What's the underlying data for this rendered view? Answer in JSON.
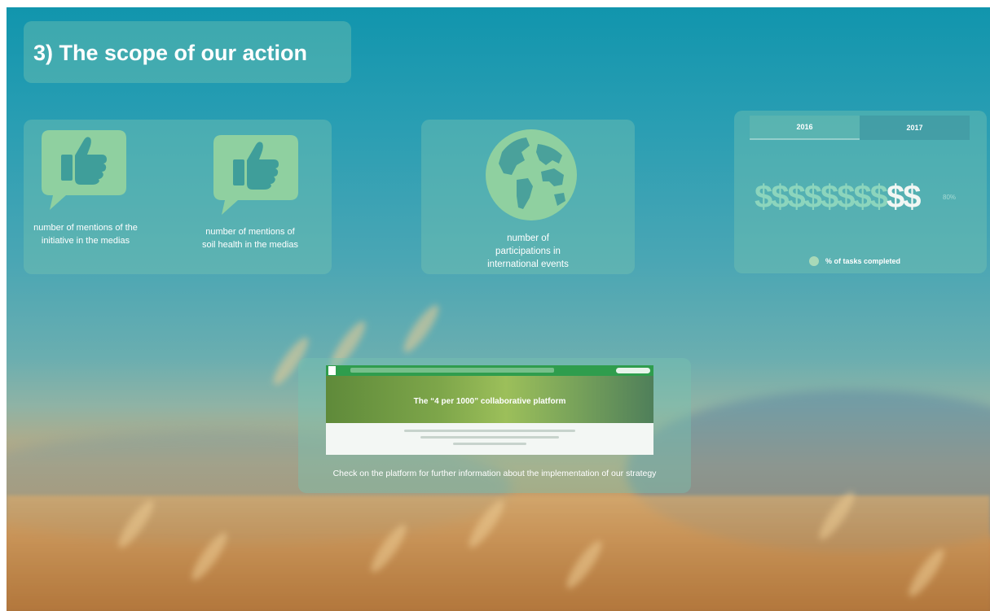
{
  "title": "3) The scope of our action",
  "stats": {
    "mentions_initiative": "number of mentions of the initiative in the medias",
    "mentions_soil": "number of mentions of soil health in the medias",
    "participations": "number of participations in international events"
  },
  "tasks": {
    "tabs": [
      "2016",
      "2017"
    ],
    "active_tab": "2016",
    "dollars_filled": "$$$$$$$$",
    "dollars_remaining": "$$",
    "percent": "80%",
    "completion_fraction": 0.8,
    "legend": "% of tasks completed"
  },
  "platform": {
    "hero_title": "The “4 per 1000” collaborative platform",
    "caption": "Check on the platform for further information about the implementation of our strategy"
  },
  "colors": {
    "accent": "#78c4b0",
    "legend_dot": "#a8d9b8",
    "platform_nav": "#2f9d4d"
  }
}
